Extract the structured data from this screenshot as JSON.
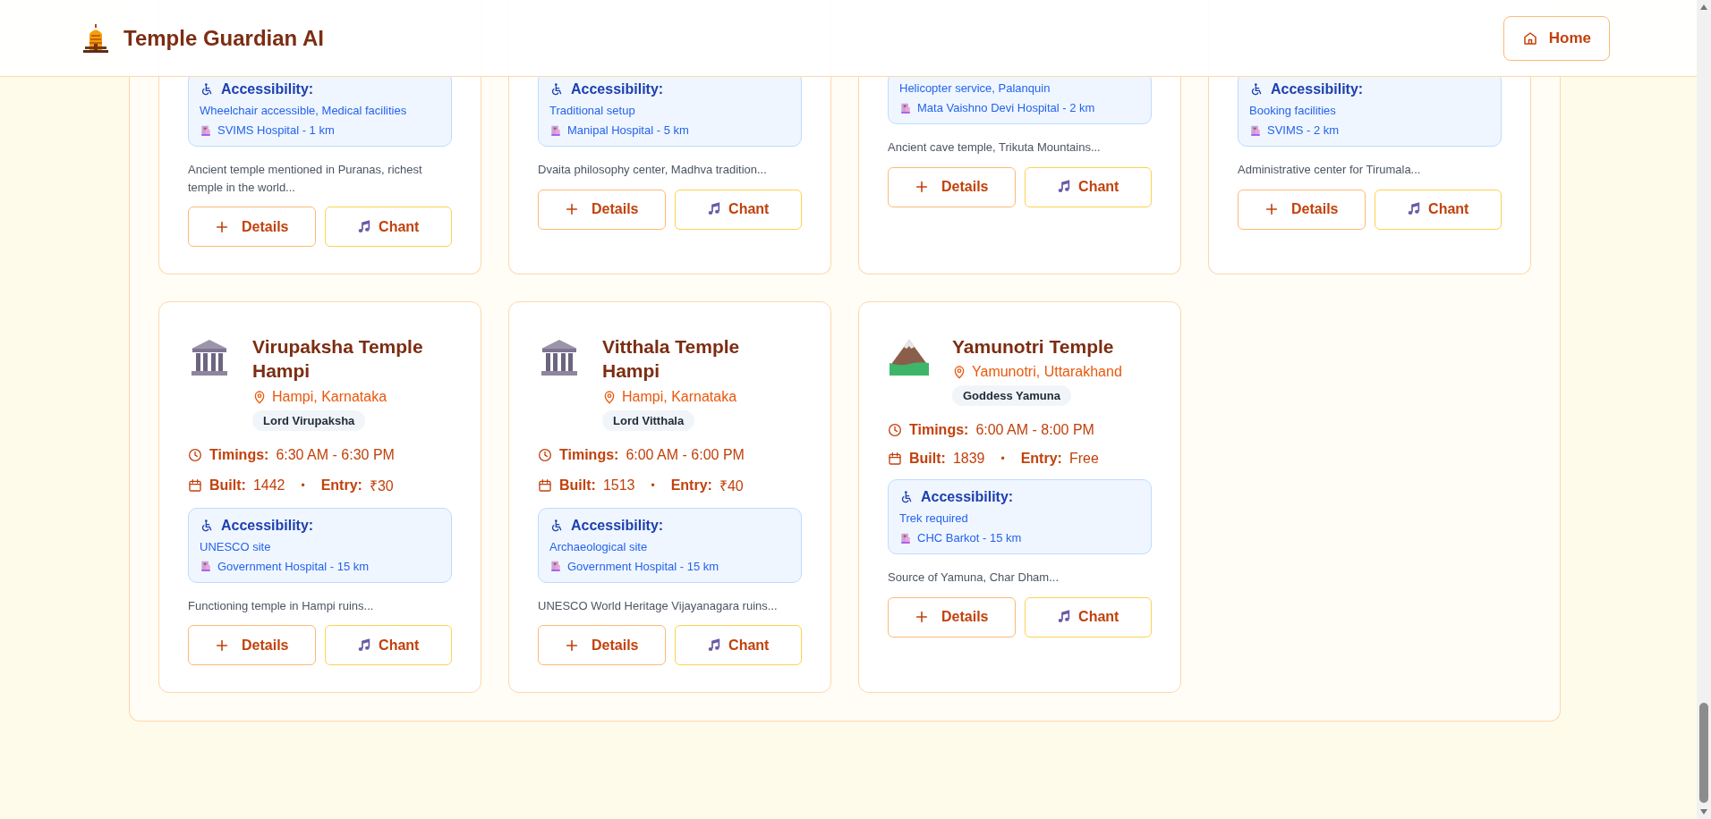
{
  "header": {
    "title": "Temple Guardian AI",
    "home_button": "Home"
  },
  "top_cards": [
    {
      "accessibility_heading": "Accessibility:",
      "accessibility_note": "Wheelchair accessible, Medical facilities",
      "hospital": "SVIMS Hospital - 1 km",
      "description": "Ancient temple mentioned in Puranas, richest temple in the world...",
      "buttons": [
        {
          "kind": "details",
          "label": "Details"
        },
        {
          "kind": "chant",
          "label": "Chant"
        }
      ]
    },
    {
      "accessibility_heading": "Accessibility:",
      "accessibility_note": "Traditional setup",
      "hospital": "Manipal Hospital - 5 km",
      "description": "Dvaita philosophy center, Madhva tradition...",
      "buttons": [
        {
          "kind": "details",
          "label": "Details"
        },
        {
          "kind": "chant",
          "label": "Chant"
        }
      ]
    },
    {
      "accessibility_note": "Helicopter service, Palanquin",
      "hospital": "Mata Vaishno Devi Hospital - 2 km",
      "description": "Ancient cave temple, Trikuta Mountains...",
      "buttons": [
        {
          "kind": "details",
          "label": "Details"
        },
        {
          "kind": "chant",
          "label": "Chant"
        }
      ]
    },
    {
      "accessibility_heading": "Accessibility:",
      "accessibility_note": "Booking facilities",
      "hospital": "SVIMS - 2 km",
      "description": "Administrative center for Tirumala...",
      "buttons": [
        {
          "kind": "details",
          "label": "Details"
        },
        {
          "kind": "chant",
          "label": "Chant"
        }
      ]
    }
  ],
  "cards": [
    {
      "kind": "classical",
      "name": "Virupaksha Temple Hampi",
      "location": "Hampi, Karnataka",
      "deity": "Lord Virupaksha",
      "timings_label": "Timings:",
      "timings": "6:30 AM - 6:30 PM",
      "built_label": "Built:",
      "built": "1442",
      "separator": "•",
      "entry_label": "Entry:",
      "entry": "₹30",
      "accessibility_heading": "Accessibility:",
      "accessibility_note": "UNESCO site",
      "hospital": "Government Hospital - 15 km",
      "description": "Functioning temple in Hampi ruins...",
      "buttons": [
        {
          "kind": "details",
          "label": "Details"
        },
        {
          "kind": "chant",
          "label": "Chant"
        }
      ]
    },
    {
      "kind": "classical",
      "name": "Vitthala Temple Hampi",
      "location": "Hampi, Karnataka",
      "deity": "Lord Vitthala",
      "timings_label": "Timings:",
      "timings": "6:00 AM - 6:00 PM",
      "built_label": "Built:",
      "built": "1513",
      "separator": "•",
      "entry_label": "Entry:",
      "entry": "₹40",
      "accessibility_heading": "Accessibility:",
      "accessibility_note": "Archaeological site",
      "hospital": "Government Hospital - 15 km",
      "description": "UNESCO World Heritage Vijayanagara ruins...",
      "buttons": [
        {
          "kind": "details",
          "label": "Details"
        },
        {
          "kind": "chant",
          "label": "Chant"
        }
      ]
    },
    {
      "kind": "mountain",
      "name": "Yamunotri Temple",
      "location": "Yamunotri, Uttarakhand",
      "deity": "Goddess Yamuna",
      "timings_label": "Timings:",
      "timings": "6:00 AM - 8:00 PM",
      "built_label": "Built:",
      "built": "1839",
      "separator": "•",
      "entry_label": "Entry:",
      "entry": "Free",
      "accessibility_heading": "Accessibility:",
      "accessibility_note": "Trek required",
      "hospital": "CHC Barkot - 15 km",
      "description": "Source of Yamuna, Char Dham...",
      "buttons": [
        {
          "kind": "details",
          "label": "Details"
        },
        {
          "kind": "chant",
          "label": "Chant"
        }
      ]
    }
  ]
}
